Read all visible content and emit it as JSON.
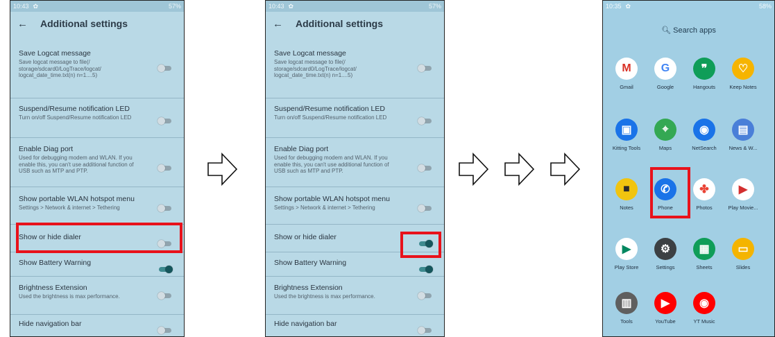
{
  "screen1": {
    "status": {
      "time": "10:43",
      "battery": "57%"
    },
    "title": "Additional settings",
    "settings": [
      {
        "title": "Save Logcat message",
        "desc": "Save logcat message to file(/ storage/sdcard0/LogTrace/logcat/ logcat_date_time.txt(n) n=1....5)",
        "on": false
      },
      {
        "title": "Suspend/Resume notification LED",
        "desc": "Turn on/off Suspend/Resume notification LED",
        "on": false
      },
      {
        "title": "Enable Diag port",
        "desc": "Used for debugging modem and WLAN. If you enable this, you can't use additional function of USB such as MTP and PTP.",
        "on": false
      },
      {
        "title": "Show portable WLAN hotspot menu",
        "desc": "Settings > Network & internet > Tethering",
        "on": false
      },
      {
        "title": "Show or hide dialer",
        "desc": "",
        "on": false
      },
      {
        "title": "Show Battery Warning",
        "desc": "",
        "on": true
      },
      {
        "title": "Brightness Extension",
        "desc": "Used the brightness is max performance.",
        "on": false
      },
      {
        "title": "Hide navigation bar",
        "desc": "",
        "on": false
      }
    ]
  },
  "screen2": {
    "status": {
      "time": "10:43",
      "battery": "57%"
    },
    "title": "Additional settings",
    "settings": [
      {
        "title": "Save Logcat message",
        "desc": "Save logcat message to file(/ storage/sdcard0/LogTrace/logcat/ logcat_date_time.txt(n) n=1....5)",
        "on": false
      },
      {
        "title": "Suspend/Resume notification LED",
        "desc": "Turn on/off Suspend/Resume notification LED",
        "on": false
      },
      {
        "title": "Enable Diag port",
        "desc": "Used for debugging modem and WLAN. If you enable this, you can't use additional function of USB such as MTP and PTP.",
        "on": false
      },
      {
        "title": "Show portable WLAN hotspot menu",
        "desc": "Settings > Network & internet > Tethering",
        "on": false
      },
      {
        "title": "Show or hide dialer",
        "desc": "",
        "on": true
      },
      {
        "title": "Show Battery Warning",
        "desc": "",
        "on": true
      },
      {
        "title": "Brightness Extension",
        "desc": "Used the brightness is max performance.",
        "on": false
      },
      {
        "title": "Hide navigation bar",
        "desc": "",
        "on": false
      }
    ]
  },
  "screen3": {
    "status": {
      "time": "10:35",
      "battery": "58%"
    },
    "search_label": "Search apps",
    "apps": [
      {
        "label": "Gmail",
        "glyph": "M",
        "icon": "gmail-icon",
        "color": "#ffffff",
        "fg": "#d93025"
      },
      {
        "label": "Google",
        "glyph": "G",
        "icon": "google-icon",
        "color": "#ffffff",
        "fg": "#4285f4"
      },
      {
        "label": "Hangouts",
        "glyph": "❞",
        "icon": "hangouts-icon",
        "color": "#0f9d58",
        "fg": "#ffffff"
      },
      {
        "label": "Keep Notes",
        "glyph": "♡",
        "icon": "keep-notes-icon",
        "color": "#f6b400",
        "fg": "#ffffff"
      },
      {
        "label": "Kitting Tools",
        "glyph": "▣",
        "icon": "kitting-tools-icon",
        "color": "#1a73e8",
        "fg": "#ffffff"
      },
      {
        "label": "Maps",
        "glyph": "⌖",
        "icon": "maps-icon",
        "color": "#34a853",
        "fg": "#ffffff"
      },
      {
        "label": "NetSearch",
        "glyph": "◉",
        "icon": "netsearch-icon",
        "color": "#1a73e8",
        "fg": "#ffffff"
      },
      {
        "label": "News & W...",
        "glyph": "▤",
        "icon": "news-weather-icon",
        "color": "#4a7fd8",
        "fg": "#ffffff"
      },
      {
        "label": "Notes",
        "glyph": "■",
        "icon": "notes-icon",
        "color": "#f1c40f",
        "fg": "#2b2b2b"
      },
      {
        "label": "Phone",
        "glyph": "✆",
        "icon": "phone-icon",
        "color": "#1a73e8",
        "fg": "#ffffff"
      },
      {
        "label": "Photos",
        "glyph": "✤",
        "icon": "photos-icon",
        "color": "#ffffff",
        "fg": "#ea4335"
      },
      {
        "label": "Play Movie...",
        "glyph": "▶",
        "icon": "play-movies-icon",
        "color": "#ffffff",
        "fg": "#d32f2f"
      },
      {
        "label": "Play Store",
        "glyph": "▶",
        "icon": "play-store-icon",
        "color": "#ffffff",
        "fg": "#01875f"
      },
      {
        "label": "Settings",
        "glyph": "⚙",
        "icon": "settings-icon",
        "color": "#3c4043",
        "fg": "#ffffff"
      },
      {
        "label": "Sheets",
        "glyph": "▦",
        "icon": "sheets-icon",
        "color": "#0f9d58",
        "fg": "#ffffff"
      },
      {
        "label": "Slides",
        "glyph": "▭",
        "icon": "slides-icon",
        "color": "#f4b400",
        "fg": "#ffffff"
      },
      {
        "label": "Tools",
        "glyph": "▥",
        "icon": "tools-icon",
        "color": "#5f5f5f",
        "fg": "#ffffff"
      },
      {
        "label": "YouTube",
        "glyph": "▶",
        "icon": "youtube-icon",
        "color": "#ff0000",
        "fg": "#ffffff"
      },
      {
        "label": "YT Music",
        "glyph": "◉",
        "icon": "yt-music-icon",
        "color": "#ff0000",
        "fg": "#ffffff"
      }
    ]
  },
  "colors": {
    "highlight": "#e8121b",
    "toggle_on": "#15565c",
    "settings_bg": "#b9d9e6"
  }
}
